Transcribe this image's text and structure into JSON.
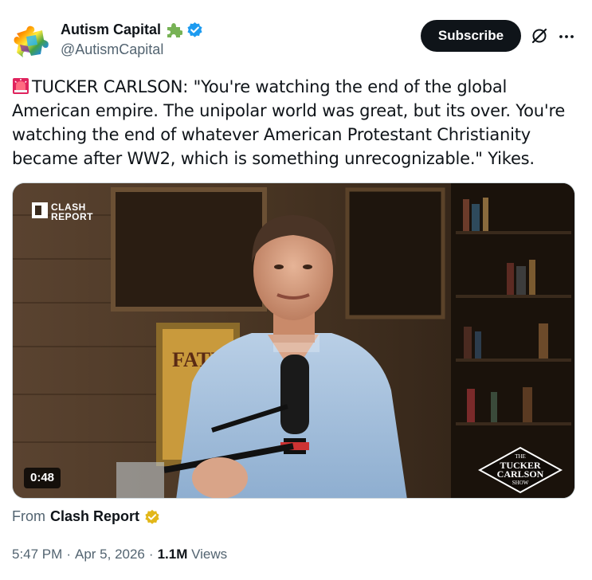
{
  "author": {
    "display_name": "Autism Capital",
    "handle": "@AutismCapital",
    "name_emoji": "puzzle-piece-icon",
    "verified": true
  },
  "actions": {
    "subscribe_label": "Subscribe",
    "grok_icon": "grok-icon",
    "more_icon": "more-icon"
  },
  "post": {
    "text": "TUCKER CARLSON: \"You're watching the end of the global American empire. The unipolar world was great, but its over. You're watching the end of whatever American Protestant Christianity became after WW2, which is something unrecognizable.\" Yikes.",
    "leading_emoji": "siren-icon"
  },
  "media": {
    "duration": "0:48",
    "watermark_line1": "CLASH",
    "watermark_line2": "REPORT",
    "badge_line1": "THE",
    "badge_line2": "TUCKER",
    "badge_line3": "CARLSON",
    "badge_line4": "SHOW"
  },
  "attribution": {
    "from_label": "From",
    "source_name": "Clash Report"
  },
  "meta": {
    "time": "5:47 PM",
    "separator": "·",
    "date": "Apr 5, 2026",
    "views_count": "1.1M",
    "views_label": "Views"
  },
  "colors": {
    "text_primary": "#0f1419",
    "text_secondary": "#536471",
    "verified_blue": "#1d9bf0",
    "gold_badge": "#e2b719",
    "button_bg": "#0f1419"
  }
}
